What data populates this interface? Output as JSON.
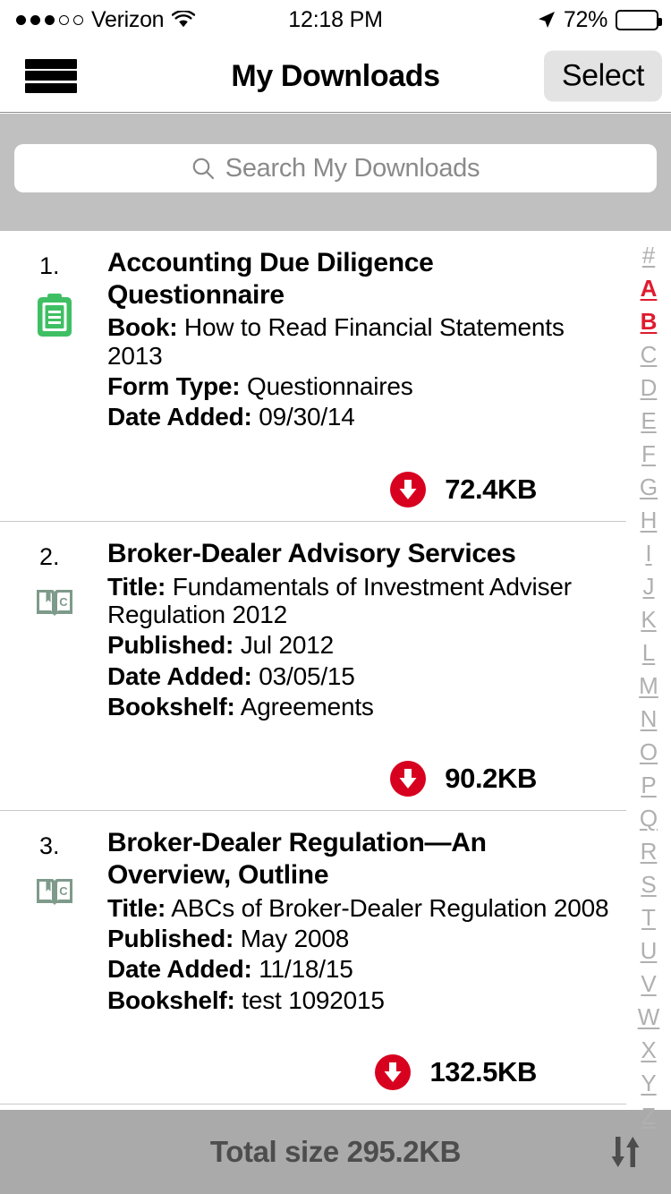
{
  "status_bar": {
    "signal_dots_filled": 3,
    "signal_dots_total": 5,
    "carrier": "Verizon",
    "wifi_icon": "wifi-icon",
    "time": "12:18 PM",
    "location_icon": "location-arrow-icon",
    "battery_percent": "72%",
    "battery_level": 72
  },
  "navbar": {
    "menu_icon": "hamburger-menu-icon",
    "title": "My Downloads",
    "select_label": "Select"
  },
  "search": {
    "icon": "search-icon",
    "placeholder": "Search My Downloads",
    "value": ""
  },
  "colors": {
    "accent_red": "#e01b2e",
    "download_badge": "#d8001f",
    "form_icon_green": "#3fbf63",
    "book_icon_green": "#7e9a8a",
    "search_bg": "#c0c0c0",
    "bottom_bar_bg": "#aaaaaa",
    "index_inactive": "#b0b0b0",
    "select_btn_bg": "#e3e3e3"
  },
  "list": {
    "items": [
      {
        "number": "1.",
        "icon": "form-document-icon",
        "title": "Accounting Due Diligence Questionnaire",
        "fields": [
          {
            "label": "Book:",
            "value": "How to Read Financial Statements 2013"
          },
          {
            "label": "Form Type:",
            "value": "Questionnaires"
          },
          {
            "label": "Date Added:",
            "value": "09/30/14"
          }
        ],
        "download_icon": "download-circle-icon",
        "size": "72.4KB"
      },
      {
        "number": "2.",
        "icon": "open-book-icon",
        "title": "Broker-Dealer Advisory Services",
        "fields": [
          {
            "label": "Title:",
            "value": "Fundamentals of Investment Adviser Regulation 2012"
          },
          {
            "label": "Published:",
            "value": "Jul 2012"
          },
          {
            "label": "Date Added:",
            "value": "03/05/15"
          },
          {
            "label": "Bookshelf:",
            "value": "Agreements"
          }
        ],
        "download_icon": "download-circle-icon",
        "size": "90.2KB"
      },
      {
        "number": "3.",
        "icon": "open-book-icon",
        "title": "Broker-Dealer Regulation—An Overview, Outline",
        "fields": [
          {
            "label": "Title:",
            "value": "ABCs of Broker-Dealer Regulation 2008"
          },
          {
            "label": "Published:",
            "value": "May 2008"
          },
          {
            "label": "Date Added:",
            "value": "11/18/15"
          },
          {
            "label": "Bookshelf:",
            "value": "test 1092015"
          }
        ],
        "download_icon": "download-circle-icon",
        "size": "132.5KB"
      }
    ]
  },
  "index_bar": {
    "entries": [
      {
        "label": "#",
        "active": false
      },
      {
        "label": "A",
        "active": true
      },
      {
        "label": "B",
        "active": true
      },
      {
        "label": "C",
        "active": false
      },
      {
        "label": "D",
        "active": false
      },
      {
        "label": "E",
        "active": false
      },
      {
        "label": "F",
        "active": false
      },
      {
        "label": "G",
        "active": false
      },
      {
        "label": "H",
        "active": false
      },
      {
        "label": "I",
        "active": false
      },
      {
        "label": "J",
        "active": false
      },
      {
        "label": "K",
        "active": false
      },
      {
        "label": "L",
        "active": false
      },
      {
        "label": "M",
        "active": false
      },
      {
        "label": "N",
        "active": false
      },
      {
        "label": "O",
        "active": false
      },
      {
        "label": "P",
        "active": false
      },
      {
        "label": "Q",
        "active": false
      },
      {
        "label": "R",
        "active": false
      },
      {
        "label": "S",
        "active": false
      },
      {
        "label": "T",
        "active": false
      },
      {
        "label": "U",
        "active": false
      },
      {
        "label": "V",
        "active": false
      },
      {
        "label": "W",
        "active": false
      },
      {
        "label": "X",
        "active": false
      },
      {
        "label": "Y",
        "active": false
      },
      {
        "label": "Z",
        "active": false
      }
    ]
  },
  "bottom_bar": {
    "total_label": "Total size 295.2KB",
    "sort_icon": "sort-updown-icon"
  }
}
